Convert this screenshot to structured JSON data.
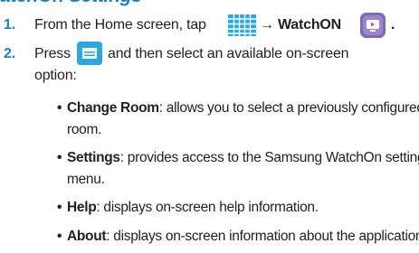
{
  "heading": "atchOn Settings",
  "steps": [
    {
      "number": "1.",
      "text_before": "From the Home screen, tap",
      "arrow": "→",
      "app_name": "WatchON",
      "end": "."
    },
    {
      "number": "2.",
      "text_before": "Press",
      "line1_after": "and then select an available on-screen",
      "line2": "option:"
    }
  ],
  "options": [
    {
      "term": "Change Room",
      "line1_rest": ": allows you to select a previously configured",
      "line2": "room."
    },
    {
      "term": "Settings",
      "line1_rest": ": provides access to the Samsung WatchOn settings",
      "line2": "menu."
    },
    {
      "term": "Help",
      "line1_rest": ": displays on-screen help information."
    },
    {
      "term": "About",
      "line1_rest": ": displays on-screen information about the application."
    }
  ],
  "bullet": "•",
  "icons": {
    "apps_icon": "apps-grid-icon",
    "watchon_icon": "watchon-app-icon",
    "menu_icon": "menu-key-icon"
  },
  "colors": {
    "accent": "#1c7fc4",
    "icon_blue": "#2aa8e0",
    "watchon_purple": "#7f6ab8",
    "text": "#231f20"
  }
}
